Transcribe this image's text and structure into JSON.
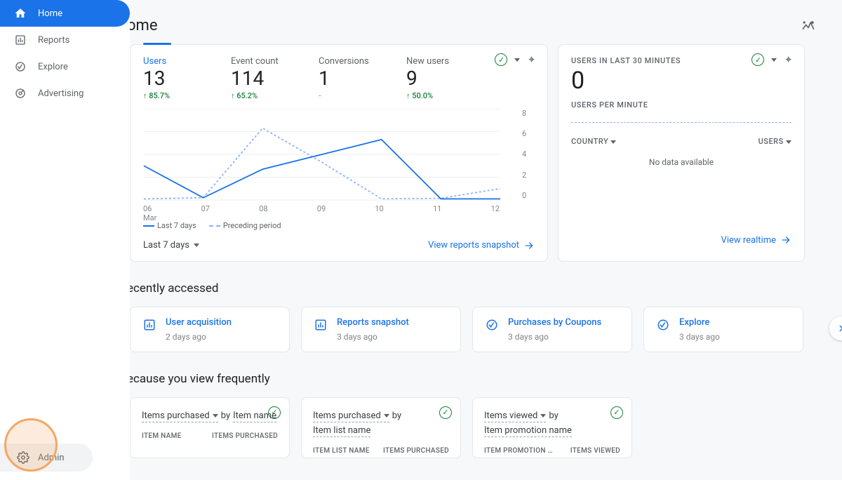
{
  "sidebar": {
    "items": [
      {
        "label": "Home"
      },
      {
        "label": "Reports"
      },
      {
        "label": "Explore"
      },
      {
        "label": "Advertising"
      }
    ],
    "admin": "Admin"
  },
  "header": {
    "title": "ome"
  },
  "metrics": [
    {
      "label": "Users",
      "value": "13",
      "delta": "85.7%"
    },
    {
      "label": "Event count",
      "value": "114",
      "delta": "65.2%"
    },
    {
      "label": "Conversions",
      "value": "1",
      "delta": "-"
    },
    {
      "label": "New users",
      "value": "9",
      "delta": "50.0%"
    }
  ],
  "chart_data": {
    "type": "line",
    "x": [
      "06",
      "07",
      "08",
      "09",
      "10",
      "11",
      "12"
    ],
    "x_sublabel": "Mar",
    "ylim": [
      0,
      8
    ],
    "y_ticks": [
      "8",
      "6",
      "4",
      "2",
      "0"
    ],
    "series": [
      {
        "name": "Last 7 days",
        "values": [
          3.0,
          0.2,
          2.7,
          4.0,
          5.3,
          0.1,
          0.1
        ]
      },
      {
        "name": "Preceding period",
        "values": [
          0.1,
          0.2,
          6.3,
          3.3,
          0.1,
          0.15,
          1.0
        ]
      }
    ],
    "legend": [
      "Last 7 days",
      "Preceding period"
    ]
  },
  "main_card": {
    "range_picker": "Last 7 days",
    "link": "View reports snapshot"
  },
  "realtime": {
    "label1": "USERS IN LAST 30 MINUTES",
    "big": "0",
    "label2": "USERS PER MINUTE",
    "col1": "COUNTRY",
    "col2": "USERS",
    "nodata": "No data available",
    "link": "View realtime"
  },
  "recent": {
    "heading": "ecently accessed",
    "items": [
      {
        "title": "User acquisition",
        "sub": "2 days ago",
        "icon": "bar"
      },
      {
        "title": "Reports snapshot",
        "sub": "3 days ago",
        "icon": "bar"
      },
      {
        "title": "Purchases by Coupons",
        "sub": "3 days ago",
        "icon": "explore"
      },
      {
        "title": "Explore",
        "sub": "3 days ago",
        "icon": "explore"
      }
    ]
  },
  "freq": {
    "heading": "ecause you view frequently",
    "cards": [
      {
        "metric": "Items purchased",
        "by": "by",
        "dim": "Item name",
        "col1": "ITEM NAME",
        "col2": "ITEMS PURCHASED"
      },
      {
        "metric": "Items purchased",
        "by": "by",
        "dim": "Item list name",
        "col1": "ITEM LIST NAME",
        "col2": "ITEMS PURCHASED"
      },
      {
        "metric": "Items viewed",
        "by": "by",
        "dim": "Item promotion name",
        "col1": "ITEM PROMOTION …",
        "col2": "ITEMS VIEWED"
      }
    ]
  }
}
